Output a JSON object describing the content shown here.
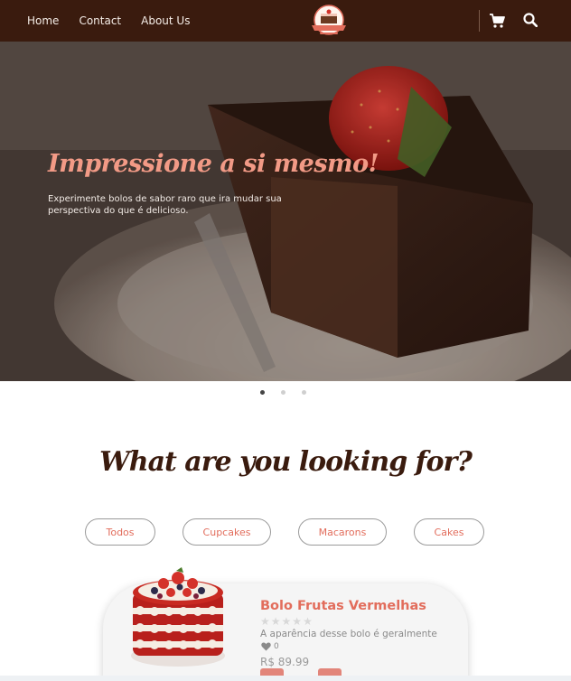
{
  "nav": {
    "links": [
      "Home",
      "Contact",
      "About Us"
    ]
  },
  "hero": {
    "title": "Impressione a si mesmo!",
    "text": "Experimente bolos de sabor raro que ira mudar sua perspectiva do que é delicioso."
  },
  "carousel": {
    "count": 3,
    "active_index": 0
  },
  "section": {
    "title": "What are you looking for?",
    "filters": [
      "Todos",
      "Cupcakes",
      "Macarons",
      "Cakes"
    ]
  },
  "product": {
    "name": "Bolo Frutas Vermelhas",
    "rating": 0,
    "rating_max": 5,
    "description": "A aparência desse bolo é geralmente",
    "likes": "0",
    "price": "R$ 89.99"
  },
  "colors": {
    "navbar": "#3a1b0e",
    "accent": "#e26d5c",
    "hero_title": "#f29a86"
  },
  "icons": {
    "cart": "cart-icon",
    "search": "search-icon",
    "heart": "heart-icon",
    "star": "star-icon",
    "logo": "bakery-logo"
  }
}
